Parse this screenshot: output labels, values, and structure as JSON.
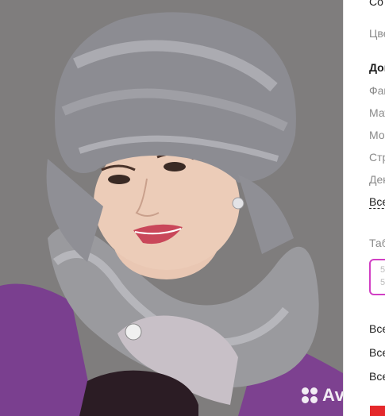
{
  "panel": {
    "top_partial": "Co",
    "color_label": "Цве",
    "section_title": "Доп",
    "items": [
      "Фак",
      "Мат",
      "Мо",
      "Стр",
      "Дек"
    ],
    "all_link": "Все",
    "table_title": "Таб",
    "chip_values": [
      "5",
      "5"
    ],
    "bottom_items": [
      "Все",
      "Все",
      "Все"
    ]
  },
  "watermark": {
    "text": "Avito"
  },
  "colors": {
    "chip_border": "#d13fc4",
    "accent_red": "#e5282b"
  }
}
